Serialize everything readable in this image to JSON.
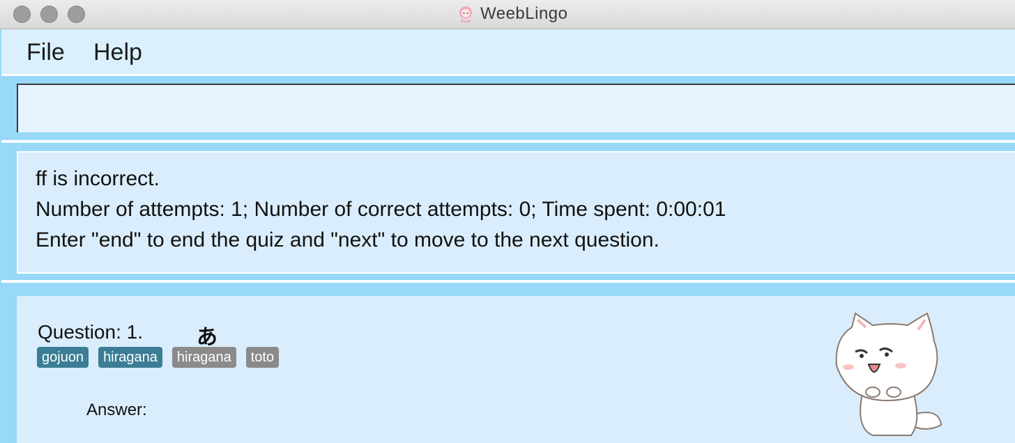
{
  "window": {
    "title": "WeebLingo",
    "app_icon": "anime-girl-icon"
  },
  "menu": {
    "file_label": "File",
    "help_label": "Help"
  },
  "command": {
    "value": "",
    "placeholder": ""
  },
  "result": {
    "lines": [
      "ff is incorrect.",
      "Number of attempts: 1; Number of correct attempts: 0; Time spent: 0:00:01",
      "Enter \"end\" to end the quiz and \"next\" to move to the next question."
    ]
  },
  "quiz": {
    "question_label": "Question: 1.",
    "question_kana": "あ",
    "tags": [
      {
        "label": "gojuon",
        "color": "#3b7d95"
      },
      {
        "label": "hiragana",
        "color": "#3b7d95"
      },
      {
        "label": "hiragana",
        "color": "#8a8a8a"
      },
      {
        "label": "toto",
        "color": "#8a8a8a"
      }
    ],
    "answer_label": "Answer:",
    "mascot": "cat-mascot-image"
  },
  "colors": {
    "background": "#98d8f8",
    "panel": "#daedfc",
    "menu": "#daf0fc"
  }
}
